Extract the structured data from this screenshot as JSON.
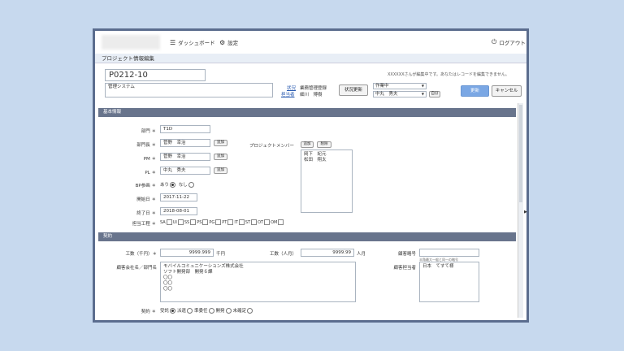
{
  "topbar": {
    "dashboard": "ダッシュボード",
    "settings": "設定",
    "logout": "ログアウト"
  },
  "page_title": "プロジェクト情報編集",
  "project": {
    "code": "P0212-10",
    "name": "管理システム",
    "lock_message": "XXXXXXさんが編集中です。あなたはレコードを編集できません。",
    "status_label": "状況",
    "status_value": "業務管理登録",
    "handler_label": "担当者",
    "handler_value": "細川　博樹",
    "status_update_btn": "状況更新",
    "select_status": "作業中",
    "select_user": "中丸　秀夫",
    "self_btn": "自分",
    "update_btn": "更新",
    "cancel_btn": "キャンセル"
  },
  "basic": {
    "section_title": "基本情報",
    "dept_label": "部門 ＊",
    "dept_value": "T1D",
    "dept_head_label": "部門長 ＊",
    "dept_head_value": "菅野　幸治",
    "pm_label": "PM ＊",
    "pm_value": "菅野　幸治",
    "pl_label": "PL ＊",
    "pl_value": "中丸　秀夫",
    "add_btn": "追加",
    "delete_btn": "削除",
    "bp_label": "BP参画 ＊",
    "bp_yes": "あり",
    "bp_no": "なし",
    "start_label": "開始日 ＊",
    "start_value": "2017-11-22",
    "end_label": "終了日 ＊",
    "end_value": "2018-08-01",
    "process_label": "担当工程 ＊",
    "processes": [
      "SA",
      "UI",
      "SS",
      "PS",
      "PG",
      "PT",
      "IT",
      "ST",
      "OT",
      "OM"
    ],
    "members_label": "プロジェクトメンバー",
    "members": "岡下　紀元\n松田　翔太"
  },
  "contract": {
    "section_title": "契約",
    "cost_yen_label": "工数（千円）＊",
    "cost_yen_value": "9999.999",
    "cost_yen_unit": "千円",
    "cost_person_label": "工数（人月）",
    "cost_person_value": "9999.99",
    "cost_person_unit": "人月",
    "customer_no_label": "顧客略号",
    "customer_no_note": "半角最大一般と同一の略号",
    "customer_label": "顧客会社名／部門名",
    "customer_value": "モバイルコミュニケーションズ株式会社\nソフト開発部　開発６課\n〇〇\n〇〇\n〇〇",
    "contact_label": "顧客担当者",
    "contact_value": "日本　てすて様",
    "contract_label": "契約 ＊",
    "contract_options": [
      "受託",
      "派遣",
      "準委任",
      "開発",
      "未確定"
    ]
  }
}
